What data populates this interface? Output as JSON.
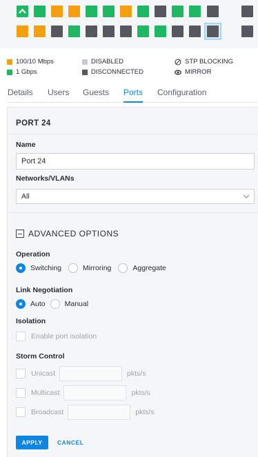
{
  "ports_panel": {
    "colors": {
      "green": "#1fb862",
      "orange": "#f4a00e",
      "gray": "#55595f",
      "selected": "#d8ecfb"
    },
    "top_row": [
      "green-uplink",
      "green",
      "orange",
      "orange",
      "green",
      "green",
      "orange",
      "green",
      "gray",
      "green",
      "green",
      "gray",
      "gray"
    ],
    "bottom_row": [
      "orange",
      "orange",
      "gray",
      "green",
      "gray",
      "gray",
      "gray",
      "green",
      "green",
      "gray",
      "gray-selected",
      "gray"
    ],
    "selected_port": 24
  },
  "legend": {
    "speed_100": "100/10 Mbps",
    "speed_1g": "1 Gbps",
    "disabled": "DISABLED",
    "disconnected": "DISCONNECTED",
    "stp_blocking": "STP BLOCKING",
    "mirror": "MIRROR",
    "stp_icon": "circle-slash-icon",
    "mirror_icon": "eye-icon"
  },
  "tabs": [
    "Details",
    "Users",
    "Guests",
    "Ports",
    "Configuration"
  ],
  "active_tab": "Ports",
  "form": {
    "port_title": "PORT 24",
    "name_label": "Name",
    "name_value": "Port 24",
    "networks_label": "Networks/VLANs",
    "networks_value": "All",
    "advanced_label": "ADVANCED OPTIONS",
    "operation_label": "Operation",
    "operation_options": [
      "Switching",
      "Mirroring",
      "Aggregate"
    ],
    "operation_selected": "Switching",
    "link_label": "Link Negotiation",
    "link_options": [
      "Auto",
      "Manual"
    ],
    "link_selected": "Auto",
    "isolation_label": "Isolation",
    "isolation_option": "Enable port isolation",
    "storm_label": "Storm Control",
    "storm_options": [
      "Unicast",
      "Multicast",
      "Broadcast"
    ],
    "storm_unit": "pkts/s",
    "apply_label": "APPLY",
    "cancel_label": "CANCEL"
  }
}
